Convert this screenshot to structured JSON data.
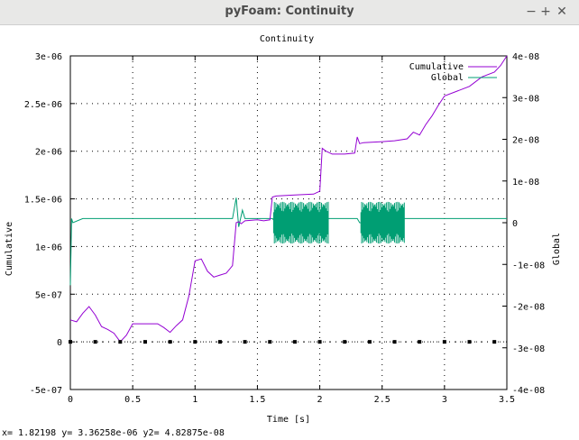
{
  "window": {
    "title": "pyFoam: Continuity",
    "minimize_label": "−",
    "maximize_label": "+",
    "close_label": "✕"
  },
  "status": {
    "readout": "x= 1.82198 y= 3.36258e-06 y2= 4.82875e-08"
  },
  "chart_data": {
    "type": "line",
    "title": "Continuity",
    "xlabel": "Time [s]",
    "ylabel": "Cumulative",
    "y2label": "Global",
    "xlim": [
      0,
      3.5
    ],
    "ylim": [
      -5e-07,
      3e-06
    ],
    "y2lim": [
      -4e-08,
      4e-08
    ],
    "x_ticks": [
      "0",
      "0.5",
      "1",
      "1.5",
      "2",
      "2.5",
      "3",
      "3.5"
    ],
    "y_ticks": [
      "-5e-07",
      "0",
      "5e-07",
      "1e-06",
      "1.5e-06",
      "2e-06",
      "2.5e-06",
      "3e-06"
    ],
    "y2_ticks": [
      "-4e-08",
      "-3e-08",
      "-2e-08",
      "-1e-08",
      "0",
      "1e-08",
      "2e-08",
      "3e-08",
      "4e-08"
    ],
    "grid": true,
    "legend_position": "top-right",
    "colors": {
      "cumulative": "#9400d3",
      "global": "#009e73",
      "zero_line": "#000000"
    },
    "series": [
      {
        "name": "Cumulative",
        "axis": "y",
        "x": [
          0,
          0.05,
          0.1,
          0.15,
          0.2,
          0.25,
          0.3,
          0.35,
          0.4,
          0.45,
          0.5,
          0.6,
          0.7,
          0.75,
          0.8,
          0.85,
          0.9,
          0.95,
          1.0,
          1.05,
          1.1,
          1.15,
          1.2,
          1.25,
          1.3,
          1.33,
          1.35,
          1.37,
          1.4,
          1.5,
          1.55,
          1.6,
          1.62,
          1.65,
          1.8,
          1.95,
          2.0,
          2.02,
          2.05,
          2.1,
          2.2,
          2.28,
          2.3,
          2.32,
          2.35,
          2.5,
          2.6,
          2.7,
          2.75,
          2.8,
          2.85,
          2.9,
          2.95,
          3.0,
          3.1,
          3.2,
          3.3,
          3.4,
          3.45,
          3.5
        ],
        "y": [
          2.3e-07,
          2.1e-07,
          3e-07,
          3.7e-07,
          2.8e-07,
          1.6e-07,
          1.3e-07,
          9e-08,
          0,
          7e-08,
          1.9e-07,
          1.9e-07,
          1.9e-07,
          1.5e-07,
          1e-07,
          1.7e-07,
          2.3e-07,
          4.8e-07,
          8.5e-07,
          8.7e-07,
          7.4e-07,
          6.8e-07,
          7e-07,
          7.2e-07,
          8e-07,
          1.25e-06,
          1.26e-06,
          1.24e-06,
          1.27e-06,
          1.28e-06,
          1.27e-06,
          1.28e-06,
          1.52e-06,
          1.53e-06,
          1.54e-06,
          1.55e-06,
          1.58e-06,
          2.03e-06,
          2e-06,
          1.97e-06,
          1.97e-06,
          1.98e-06,
          2.15e-06,
          2.08e-06,
          2.09e-06,
          2.1e-06,
          2.11e-06,
          2.13e-06,
          2.2e-06,
          2.17e-06,
          2.28e-06,
          2.37e-06,
          2.48e-06,
          2.58e-06,
          2.63e-06,
          2.68e-06,
          2.78e-06,
          2.83e-06,
          2.9e-06,
          3e-06
        ]
      },
      {
        "name": "Global",
        "axis": "y2",
        "x": [
          0,
          0.01,
          0.02,
          0.1,
          0.3,
          0.5,
          0.7,
          0.9,
          1.0,
          1.1,
          1.2,
          1.3,
          1.33,
          1.35,
          1.38,
          1.4,
          1.5,
          1.6,
          1.62,
          1.65,
          1.8,
          1.95,
          2.0,
          2.1,
          2.2,
          2.3,
          2.32,
          2.5,
          2.68,
          2.7,
          2.9,
          3.1,
          3.3,
          3.5
        ],
        "y": [
          -1.5e-08,
          1e-09,
          0,
          1e-09,
          1e-09,
          1e-09,
          1e-09,
          1e-09,
          1e-09,
          1e-09,
          1e-09,
          1e-09,
          6e-09,
          -1e-09,
          3e-09,
          1e-09,
          1e-09,
          1e-09,
          1e-09,
          0,
          0,
          0,
          1e-09,
          1e-09,
          1e-09,
          1e-09,
          0,
          0,
          1e-09,
          1e-09,
          1e-09,
          1e-09,
          1e-09,
          1e-09
        ],
        "noisy_bands": [
          [
            1.63,
            2.07
          ],
          [
            2.33,
            2.68
          ]
        ],
        "band_amplitude": 5e-09
      }
    ],
    "zero_line_points": [
      0,
      0.2,
      0.4,
      0.6,
      0.8,
      1.0,
      1.2,
      1.4,
      1.6,
      1.8,
      2.0,
      2.2,
      2.4,
      2.6,
      2.8,
      3.0,
      3.2,
      3.4
    ]
  }
}
